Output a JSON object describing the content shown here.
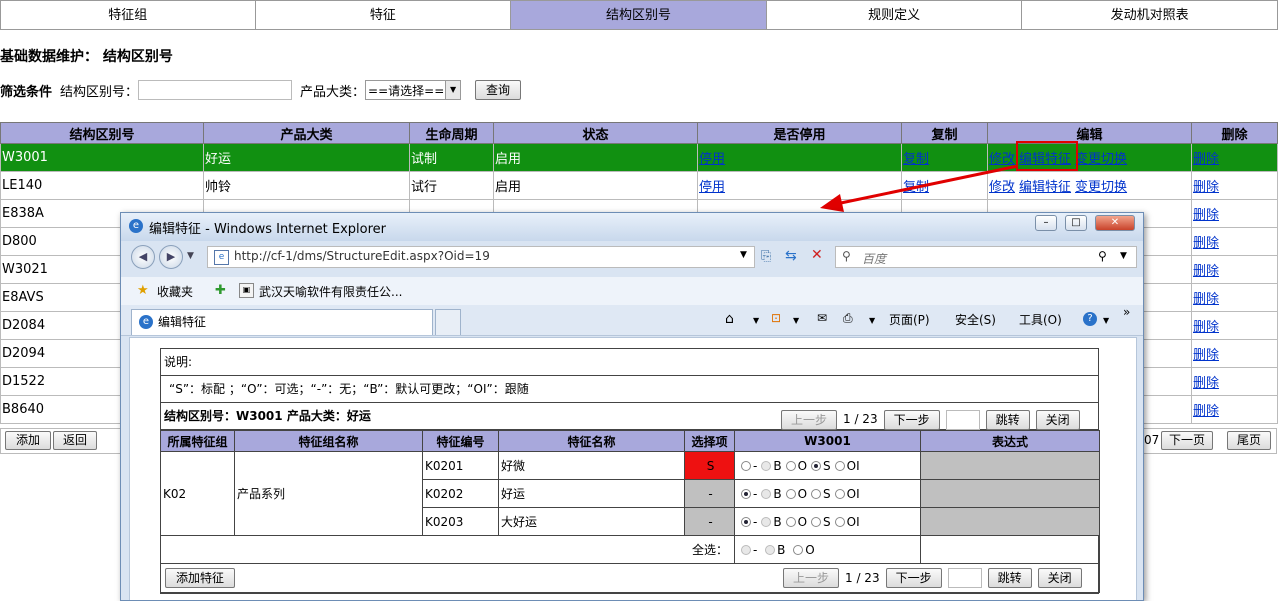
{
  "top_tabs": [
    "特征组",
    "特征",
    "结构区别号",
    "规则定义",
    "发动机对照表"
  ],
  "page_title": "基础数据维护： 结构区别号",
  "filter": {
    "label": "筛选条件",
    "field1_label": "结构区别号：",
    "field2_label": "产品大类：",
    "select_value": "==请选择==",
    "query_button": "查询"
  },
  "grid": {
    "headers": [
      "结构区别号",
      "产品大类",
      "生命周期",
      "状态",
      "是否停用",
      "复制",
      "编辑",
      "删除"
    ],
    "rows": [
      {
        "code": "W3001",
        "cat": "好运",
        "life": "试制",
        "status": "启用",
        "stop": "停用",
        "copy": "复制",
        "edit1": "修改",
        "edit2": "编辑特征",
        "edit3": "变更切换",
        "del": "删除"
      },
      {
        "code": "LE140",
        "cat": "帅铃",
        "life": "试行",
        "status": "启用",
        "stop": "停用",
        "copy": "复制",
        "edit1": "修改",
        "edit2": "编辑特征",
        "edit3": "变更切换",
        "del": "删除"
      },
      {
        "code": "E838A",
        "cat": "",
        "life": "",
        "status": "",
        "stop": "",
        "copy": "",
        "edit1": "",
        "edit2": "",
        "edit3": "",
        "del": "删除"
      },
      {
        "code": "D800",
        "cat": "",
        "life": "",
        "status": "",
        "stop": "",
        "copy": "",
        "edit1": "",
        "edit2": "",
        "edit3": "",
        "del": "删除"
      },
      {
        "code": "W3021",
        "cat": "",
        "life": "",
        "status": "",
        "stop": "",
        "copy": "",
        "edit1": "",
        "edit2": "",
        "edit3": "",
        "del": "删除"
      },
      {
        "code": "E8AVS",
        "cat": "",
        "life": "",
        "status": "",
        "stop": "",
        "copy": "",
        "edit1": "",
        "edit2": "",
        "edit3": "",
        "del": "删除"
      },
      {
        "code": "D2084",
        "cat": "",
        "life": "",
        "status": "",
        "stop": "",
        "copy": "",
        "edit1": "",
        "edit2": "",
        "edit3": "",
        "del": "删除"
      },
      {
        "code": "D2094",
        "cat": "",
        "life": "",
        "status": "",
        "stop": "",
        "copy": "",
        "edit1": "",
        "edit2": "",
        "edit3": "",
        "del": "删除"
      },
      {
        "code": "D1522",
        "cat": "",
        "life": "",
        "status": "",
        "stop": "",
        "copy": "",
        "edit1": "",
        "edit2": "",
        "edit3": "",
        "del": "删除"
      },
      {
        "code": "B8640",
        "cat": "",
        "life": "",
        "status": "",
        "stop": "",
        "copy": "",
        "edit1": "",
        "edit2": "",
        "edit3": "",
        "del": "删除"
      }
    ],
    "add_button": "添加",
    "back_button": "返回",
    "page_fragment": "07",
    "next_page": "下一页",
    "last_page": "尾页"
  },
  "popup": {
    "title": "编辑特征 - Windows Internet Explorer",
    "address": "http://cf-1/dms/StructureEdit.aspx?Oid=19",
    "search_placeholder": "百度",
    "favorites_label": "收藏夹",
    "fav_link": "武汉天喻软件有限责任公...",
    "tab_label": "编辑特征",
    "cmd_page": "页面(P)",
    "cmd_safety": "安全(S)",
    "cmd_tools": "工具(O)",
    "desc_label": "说明:",
    "desc_text": "“S”：标配 ；“O”：可选；“-”：无；“B”：默认可更改；“OI”：跟随",
    "summary": "结构区别号：W3001  产品大类：好运",
    "prev": "上一步",
    "page": "1 / 23",
    "next": "下一步",
    "jump": "跳转",
    "close": "关闭",
    "headers": [
      "所属特征组",
      "特征组名称",
      "特征编号",
      "特征名称",
      "选择项",
      "W3001",
      "表达式"
    ],
    "group_code": "K02",
    "group_name": "产品系列",
    "features": [
      {
        "code": "K0201",
        "name": "好微",
        "sel": "S",
        "checked": "S"
      },
      {
        "code": "K0202",
        "name": "好运",
        "sel": "-",
        "checked": "-"
      },
      {
        "code": "K0203",
        "name": "大好运",
        "sel": "-",
        "checked": "-"
      }
    ],
    "options": [
      "-",
      "B",
      "O",
      "S",
      "OI"
    ],
    "select_all": "全选：",
    "add_feature": "添加特征"
  }
}
